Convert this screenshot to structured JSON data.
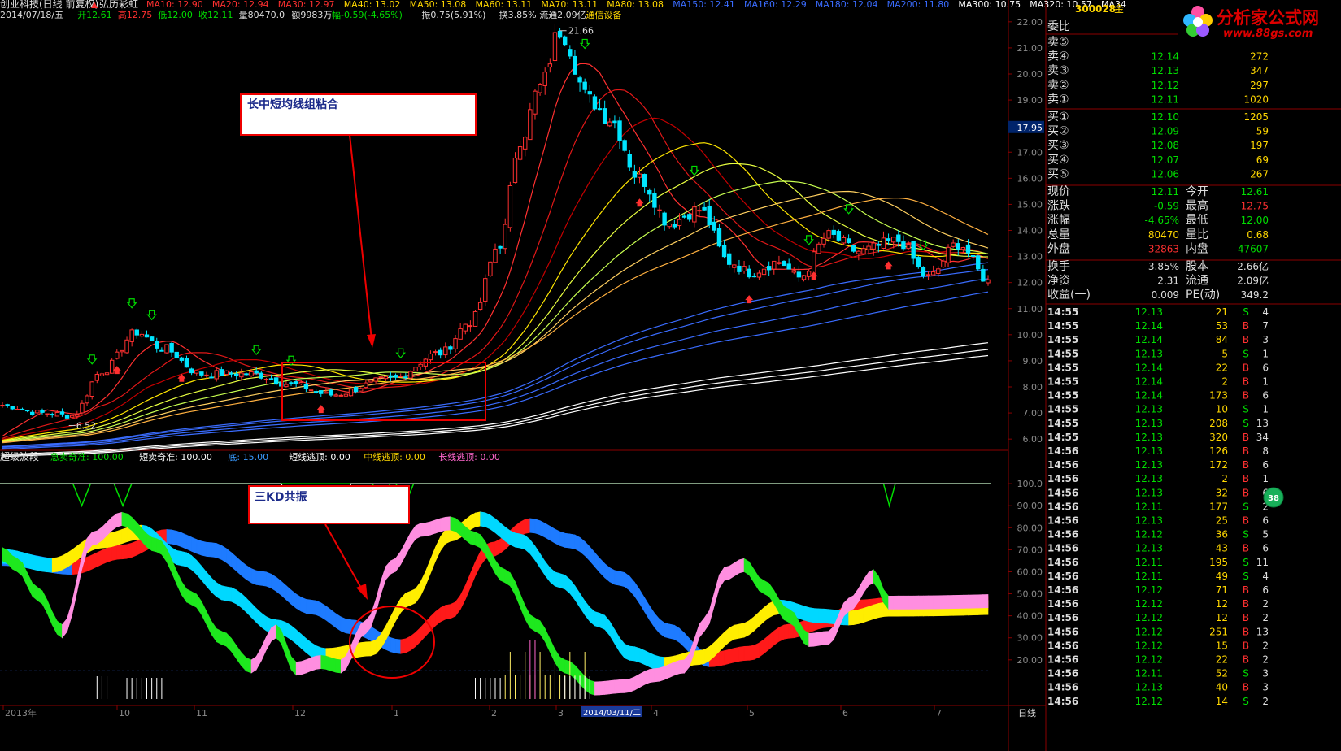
{
  "title_bar": {
    "name": "创业科技(日线 前复权)",
    "indicator_name": "弘历彩虹",
    "ma": [
      {
        "label": "MA10: 12.90",
        "color": "#ff3030"
      },
      {
        "label": "MA20: 12.94",
        "color": "#ff3030"
      },
      {
        "label": "MA30: 12.97",
        "color": "#ff3030"
      },
      {
        "label": "MA40: 13.02",
        "color": "#ffd700"
      },
      {
        "label": "MA50: 13.08",
        "color": "#ffd700"
      },
      {
        "label": "MA60: 13.11",
        "color": "#ffd700"
      },
      {
        "label": "MA70: 13.11",
        "color": "#ffd700"
      },
      {
        "label": "MA80: 13.08",
        "color": "#ffd700"
      },
      {
        "label": "MA150: 12.41",
        "color": "#3a6cff"
      },
      {
        "label": "MA160: 12.29",
        "color": "#3a6cff"
      },
      {
        "label": "MA180: 12.04",
        "color": "#3a6cff"
      },
      {
        "label": "MA200: 11.80",
        "color": "#3a6cff"
      },
      {
        "label": "MA300: 10.75",
        "color": "#ffffff"
      },
      {
        "label": "MA320: 10.57",
        "color": "#ffffff"
      },
      {
        "label": "MA34",
        "color": "#ffffff"
      }
    ]
  },
  "info_line": {
    "date": "2014/07/18/五",
    "open": "开12.61",
    "high": "高12.75",
    "low": "低12.00",
    "close": "收12.11",
    "volume": "量80470.0",
    "amount": "额9983万",
    "change": "幅-0.59(-4.65%)",
    "amplitude": "振0.75(5.91%)",
    "turnover": "换3.85%",
    "float_cap": "流通2.09亿",
    "sector": "通信设备"
  },
  "chart_data": [
    {
      "type": "candlestick",
      "title": "",
      "ylim": [
        5.6,
        22.4
      ],
      "y_ticks": [
        "22.00",
        "21.00",
        "20.00",
        "19.00",
        "18.00",
        "17.00",
        "16.00",
        "15.00",
        "14.00",
        "13.00",
        "12.00",
        "11.00",
        "10.00",
        "9.00",
        "8.00",
        "7.00",
        "6.00"
      ],
      "current_price_marker": "17.95",
      "annotations": {
        "high_label": "21.66",
        "low_label": "6.52"
      },
      "x_ticks": [
        "2013年",
        "10",
        "11",
        "12",
        "1",
        "2",
        "3",
        "2014/03/11/二",
        "4",
        "5",
        "6",
        "7"
      ],
      "keypoints_close": [
        [
          0,
          7.3
        ],
        [
          8,
          7.0
        ],
        [
          14,
          6.9
        ],
        [
          20,
          8.6
        ],
        [
          27,
          10.1
        ],
        [
          32,
          9.5
        ],
        [
          40,
          8.5
        ],
        [
          50,
          8.5
        ],
        [
          58,
          8.1
        ],
        [
          66,
          7.7
        ],
        [
          78,
          8.3
        ],
        [
          88,
          9.3
        ],
        [
          94,
          10.5
        ],
        [
          100,
          13.5
        ],
        [
          104,
          17.5
        ],
        [
          108,
          19.5
        ],
        [
          112,
          21.66
        ],
        [
          118,
          19.0
        ],
        [
          122,
          18.3
        ],
        [
          128,
          16.0
        ],
        [
          134,
          14.3
        ],
        [
          140,
          14.8
        ],
        [
          146,
          12.8
        ],
        [
          150,
          12.4
        ],
        [
          156,
          12.8
        ],
        [
          160,
          12.2
        ],
        [
          166,
          13.8
        ],
        [
          172,
          13.2
        ],
        [
          180,
          13.6
        ],
        [
          186,
          12.2
        ],
        [
          192,
          13.5
        ],
        [
          198,
          12.11
        ]
      ],
      "ma_groups": [
        {
          "name": "MA10-MA30",
          "color": "#ff3030",
          "periods": [
            10,
            20,
            30
          ]
        },
        {
          "name": "MA40-MA80",
          "color": "#ffd700",
          "periods": [
            40,
            50,
            60,
            70,
            80
          ]
        },
        {
          "name": "MA150-MA200",
          "color": "#3a6cff",
          "periods": [
            150,
            160,
            180,
            200
          ]
        },
        {
          "name": "MA300-MA340",
          "color": "#ffffff",
          "periods": [
            300,
            320,
            340
          ]
        }
      ]
    },
    {
      "type": "area",
      "title": "超级波段",
      "ylim": [
        0,
        110
      ],
      "y_ticks": [
        "100.0",
        "90.00",
        "80.00",
        "70.00",
        "60.00",
        "50.00",
        "40.00",
        "30.00",
        "20.00"
      ],
      "series": [
        {
          "name": "急卖奇准",
          "value": "100.00",
          "color": "#00dd00"
        },
        {
          "name": "短卖奇准",
          "value": "100.00",
          "color": "#ffffff"
        },
        {
          "name": "底",
          "value": "15.00",
          "color": "#3a9aff"
        },
        {
          "name": "短线逃顶",
          "value": "0.00",
          "color": "#ffffff"
        },
        {
          "name": "中线逃顶",
          "value": "0.00",
          "color": "#ffd700"
        },
        {
          "name": "长线逃顶",
          "value": "0.00",
          "color": "#ff66cc"
        }
      ],
      "kd_fast": [
        [
          0,
          68
        ],
        [
          3,
          63
        ],
        [
          7,
          50
        ],
        [
          12,
          33
        ],
        [
          18,
          75
        ],
        [
          24,
          84
        ],
        [
          31,
          72
        ],
        [
          38,
          48
        ],
        [
          44,
          30
        ],
        [
          50,
          17
        ],
        [
          55,
          33
        ],
        [
          59,
          16
        ],
        [
          64,
          19
        ],
        [
          68,
          17
        ],
        [
          73,
          35
        ],
        [
          78,
          62
        ],
        [
          84,
          79
        ],
        [
          90,
          82
        ],
        [
          95,
          75
        ],
        [
          101,
          58
        ],
        [
          107,
          36
        ],
        [
          113,
          17
        ],
        [
          119,
          7
        ],
        [
          125,
          8
        ],
        [
          131,
          13
        ],
        [
          137,
          17
        ],
        [
          141,
          36
        ],
        [
          145,
          59
        ],
        [
          149,
          63
        ],
        [
          153,
          53
        ],
        [
          158,
          40
        ],
        [
          162,
          29
        ],
        [
          166,
          30
        ],
        [
          170,
          45
        ],
        [
          175,
          58
        ],
        [
          178,
          46
        ]
      ],
      "kd_mid": [
        [
          0,
          67
        ],
        [
          10,
          63
        ],
        [
          20,
          74
        ],
        [
          28,
          78
        ],
        [
          36,
          66
        ],
        [
          45,
          50
        ],
        [
          55,
          35
        ],
        [
          65,
          22
        ],
        [
          74,
          25
        ],
        [
          82,
          48
        ],
        [
          90,
          77
        ],
        [
          96,
          84
        ],
        [
          104,
          74
        ],
        [
          112,
          56
        ],
        [
          120,
          38
        ],
        [
          126,
          23
        ],
        [
          133,
          18
        ],
        [
          140,
          21
        ],
        [
          148,
          33
        ],
        [
          156,
          44
        ],
        [
          164,
          40
        ],
        [
          170,
          39
        ],
        [
          178,
          43
        ]
      ],
      "kd_slow": [
        [
          0,
          66
        ],
        [
          14,
          62
        ],
        [
          24,
          69
        ],
        [
          33,
          76
        ],
        [
          42,
          70
        ],
        [
          52,
          57
        ],
        [
          62,
          44
        ],
        [
          70,
          35
        ],
        [
          80,
          26
        ],
        [
          90,
          42
        ],
        [
          98,
          70
        ],
        [
          106,
          81
        ],
        [
          114,
          74
        ],
        [
          124,
          57
        ],
        [
          134,
          33
        ],
        [
          142,
          20
        ],
        [
          150,
          23
        ],
        [
          158,
          33
        ],
        [
          166,
          38
        ],
        [
          172,
          44
        ],
        [
          178,
          45
        ]
      ],
      "bar_labels": []
    }
  ],
  "annotations": [
    {
      "id": "ma-converge",
      "text": "长中短均线组粘合"
    },
    {
      "id": "kd-resonance",
      "text": "三KD共振"
    }
  ],
  "cursor_date": "2014/03/11/二",
  "period_label": "日线",
  "quote_panel": {
    "code": "300028",
    "code_suffix": "金",
    "weibi_label": "委比",
    "sells": [
      {
        "label": "卖⑤",
        "price": "",
        "vol": ""
      },
      {
        "label": "卖④",
        "price": "12.14",
        "vol": "272"
      },
      {
        "label": "卖③",
        "price": "12.13",
        "vol": "347"
      },
      {
        "label": "卖②",
        "price": "12.12",
        "vol": "297"
      },
      {
        "label": "卖①",
        "price": "12.11",
        "vol": "1020"
      }
    ],
    "buys": [
      {
        "label": "买①",
        "price": "12.10",
        "vol": "1205"
      },
      {
        "label": "买②",
        "price": "12.09",
        "vol": "59"
      },
      {
        "label": "买③",
        "price": "12.08",
        "vol": "197"
      },
      {
        "label": "买④",
        "price": "12.07",
        "vol": "69"
      },
      {
        "label": "买⑤",
        "price": "12.06",
        "vol": "267"
      }
    ],
    "stats": [
      {
        "l1": "现价",
        "v1": "12.11",
        "c1": "#00dd00",
        "l2": "今开",
        "v2": "12.61",
        "c2": "#00dd00"
      },
      {
        "l1": "涨跌",
        "v1": "-0.59",
        "c1": "#00dd00",
        "l2": "最高",
        "v2": "12.75",
        "c2": "#ff3030"
      },
      {
        "l1": "涨幅",
        "v1": "-4.65%",
        "c1": "#00dd00",
        "l2": "最低",
        "v2": "12.00",
        "c2": "#00dd00"
      },
      {
        "l1": "总量",
        "v1": "80470",
        "c1": "#ffd700",
        "l2": "量比",
        "v2": "0.68",
        "c2": "#ffd700"
      },
      {
        "l1": "外盘",
        "v1": "32863",
        "c1": "#ff3030",
        "l2": "内盘",
        "v2": "47607",
        "c2": "#00dd00"
      }
    ],
    "stats2": [
      {
        "l1": "换手",
        "v1": "3.85%",
        "l2": "股本",
        "v2": "2.66亿"
      },
      {
        "l1": "净资",
        "v1": "2.31",
        "l2": "流通",
        "v2": "2.09亿"
      },
      {
        "l1": "收益(一)",
        "v1": "0.009",
        "l2": "PE(动)",
        "v2": "349.2"
      }
    ],
    "ticks": [
      [
        "14:55",
        "12.13",
        "21",
        "S",
        "4"
      ],
      [
        "14:55",
        "12.14",
        "53",
        "B",
        "7"
      ],
      [
        "14:55",
        "12.14",
        "84",
        "B",
        "3"
      ],
      [
        "14:55",
        "12.13",
        "5",
        "S",
        "1"
      ],
      [
        "14:55",
        "12.14",
        "22",
        "B",
        "6"
      ],
      [
        "14:55",
        "12.14",
        "2",
        "B",
        "1"
      ],
      [
        "14:55",
        "12.14",
        "173",
        "B",
        "6"
      ],
      [
        "14:55",
        "12.13",
        "10",
        "S",
        "1"
      ],
      [
        "14:55",
        "12.13",
        "208",
        "S",
        "13"
      ],
      [
        "14:55",
        "12.13",
        "320",
        "B",
        "34"
      ],
      [
        "14:56",
        "12.13",
        "126",
        "B",
        "8"
      ],
      [
        "14:56",
        "12.13",
        "172",
        "B",
        "6"
      ],
      [
        "14:56",
        "12.13",
        "2",
        "B",
        "1"
      ],
      [
        "14:56",
        "12.13",
        "32",
        "B",
        "6"
      ],
      [
        "14:56",
        "12.11",
        "177",
        "S",
        "2"
      ],
      [
        "14:56",
        "12.13",
        "25",
        "B",
        "6"
      ],
      [
        "14:56",
        "12.12",
        "36",
        "S",
        "5"
      ],
      [
        "14:56",
        "12.13",
        "43",
        "B",
        "6"
      ],
      [
        "14:56",
        "12.11",
        "195",
        "S",
        "11"
      ],
      [
        "14:56",
        "12.11",
        "49",
        "S",
        "4"
      ],
      [
        "14:56",
        "12.12",
        "71",
        "B",
        "6"
      ],
      [
        "14:56",
        "12.12",
        "12",
        "B",
        "2"
      ],
      [
        "14:56",
        "12.12",
        "12",
        "B",
        "2"
      ],
      [
        "14:56",
        "12.12",
        "251",
        "B",
        "13"
      ],
      [
        "14:56",
        "12.12",
        "15",
        "B",
        "2"
      ],
      [
        "14:56",
        "12.12",
        "22",
        "B",
        "2"
      ],
      [
        "14:56",
        "12.11",
        "52",
        "S",
        "3"
      ],
      [
        "14:56",
        "12.13",
        "40",
        "B",
        "3"
      ],
      [
        "14:56",
        "12.12",
        "14",
        "S",
        "2"
      ]
    ]
  },
  "watermark": {
    "brand": "分析家公式网",
    "url": "www.88gs.com"
  },
  "badge": "38"
}
